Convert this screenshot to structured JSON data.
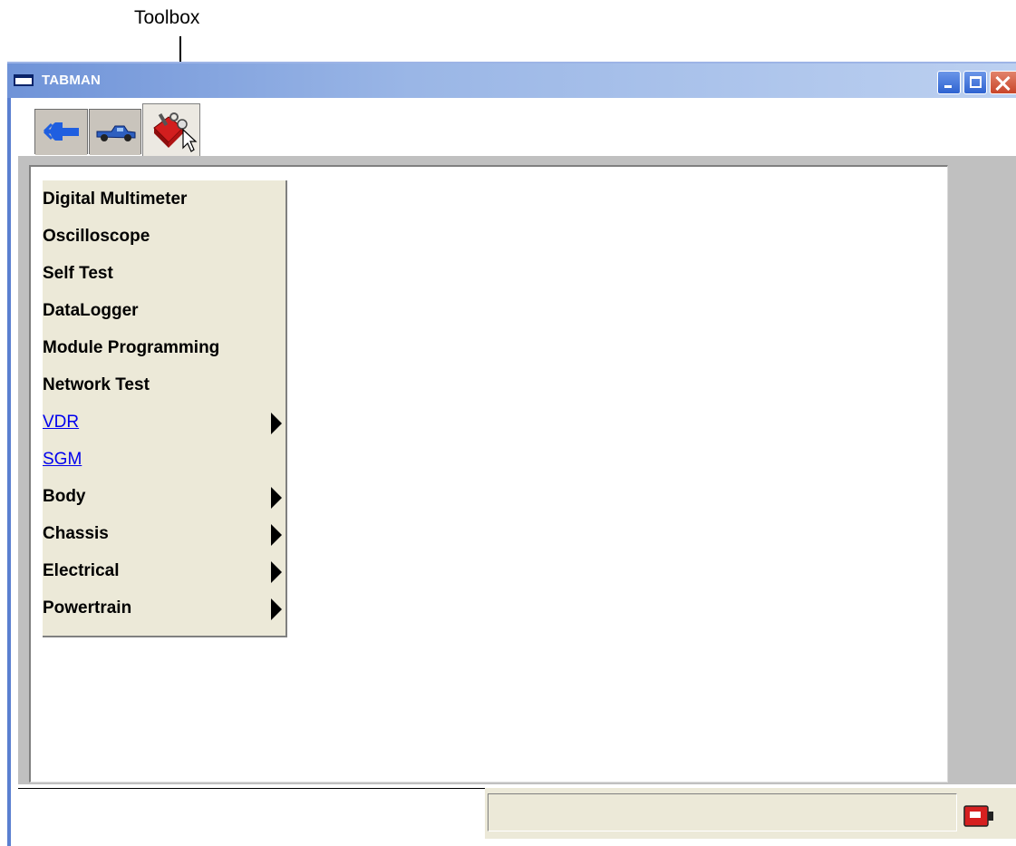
{
  "annotation": {
    "label": "Toolbox"
  },
  "window": {
    "title": "TABMAN",
    "controls": [
      "minimize",
      "maximize",
      "close"
    ]
  },
  "tabs": [
    {
      "name": "connector-tab",
      "icon": "connector-plug-icon",
      "selected": false
    },
    {
      "name": "vehicle-tab",
      "icon": "pickup-truck-icon",
      "selected": false
    },
    {
      "name": "toolbox-tab",
      "icon": "toolbox-cursor-icon",
      "selected": true
    }
  ],
  "menu": {
    "items": [
      {
        "label": "Digital Multimeter",
        "link": false,
        "submenu": false
      },
      {
        "label": "Oscilloscope",
        "link": false,
        "submenu": false
      },
      {
        "label": "Self Test",
        "link": false,
        "submenu": false
      },
      {
        "label": "DataLogger",
        "link": false,
        "submenu": false
      },
      {
        "label": "Module Programming",
        "link": false,
        "submenu": false
      },
      {
        "label": "Network Test",
        "link": false,
        "submenu": false
      },
      {
        "label": "VDR",
        "link": true,
        "submenu": true
      },
      {
        "label": "SGM",
        "link": true,
        "submenu": false
      },
      {
        "label": "Body",
        "link": false,
        "submenu": true
      },
      {
        "label": "Chassis",
        "link": false,
        "submenu": true
      },
      {
        "label": "Electrical",
        "link": false,
        "submenu": true
      },
      {
        "label": "Powertrain",
        "link": false,
        "submenu": true
      }
    ]
  },
  "statusbar": {
    "text": "",
    "device_icon": "vcm-device-icon"
  },
  "colors": {
    "titlebar": "#7b9be0",
    "menu_bg": "#ece9d8",
    "link": "#0000ee",
    "client_bg": "#c0c0c0"
  }
}
